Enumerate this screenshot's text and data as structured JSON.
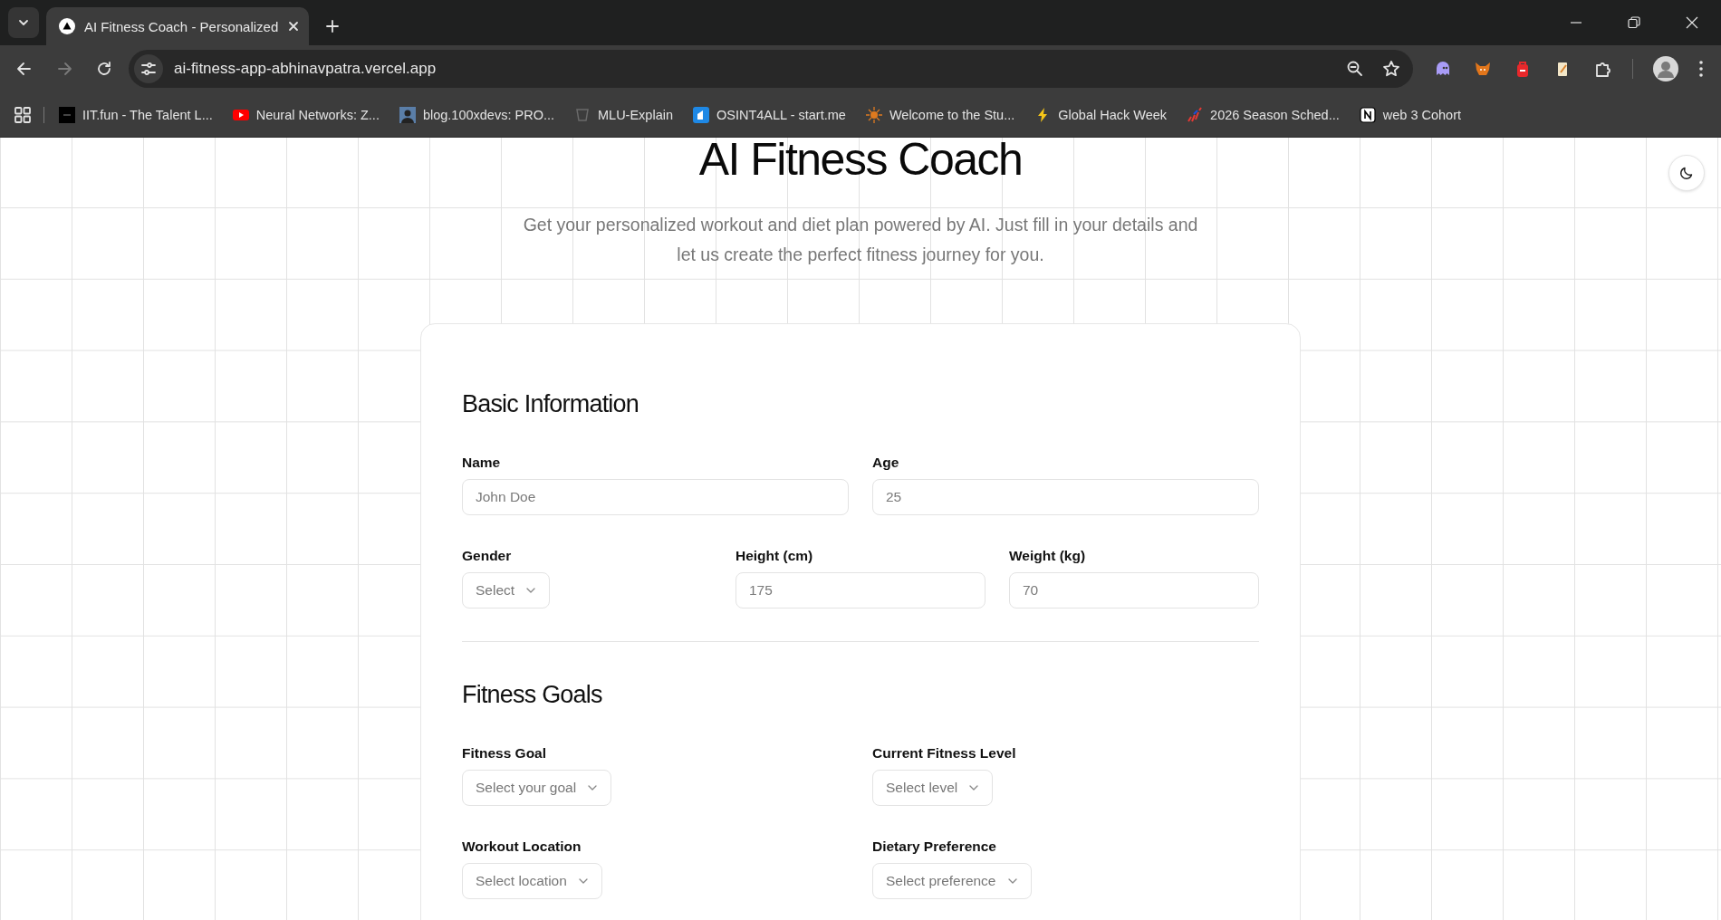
{
  "browser": {
    "tabs": [
      {
        "title": "AI Fitness Coach - Personalized",
        "selected": true
      }
    ],
    "nav": [
      {
        "kind": "back",
        "disabled": false
      },
      {
        "kind": "forward",
        "disabled": true
      },
      {
        "kind": "reload",
        "disabled": false
      }
    ],
    "address": "ai-fitness-app-abhinavpatra.vercel.app",
    "extensions": [
      {
        "kind": "ghost"
      },
      {
        "kind": "fox"
      },
      {
        "kind": "backpack"
      },
      {
        "kind": "note"
      },
      {
        "kind": "puzzle"
      }
    ],
    "bookmarks": [
      {
        "label": "IIT.fun - The Talent L...",
        "kind": "square"
      },
      {
        "label": "Neural Networks: Z...",
        "kind": "play"
      },
      {
        "label": "blog.100xdevs: PRO...",
        "kind": "avatar"
      },
      {
        "label": "MLU-Explain",
        "kind": "outline"
      },
      {
        "label": "OSINT4ALL - start.me",
        "kind": "tile"
      },
      {
        "label": "Welcome to the Stu...",
        "kind": "sun"
      },
      {
        "label": "Global Hack Week",
        "kind": "bolt"
      },
      {
        "label": "2026 Season Sched...",
        "kind": "bars"
      },
      {
        "label": "web 3 Cohort",
        "kind": "notion"
      }
    ]
  },
  "page": {
    "title": "AI Fitness Coach",
    "subtitle": "Get your personalized workout and diet plan powered by AI. Just fill in your details and let us create the perfect fitness journey for you.",
    "sections": [
      {
        "heading": "Basic Information",
        "rows": [
          [
            {
              "label": "Name",
              "kind": "input",
              "placeholder": "John Doe"
            },
            {
              "label": "Age",
              "kind": "input",
              "placeholder": "25"
            }
          ],
          [
            {
              "label": "Gender",
              "kind": "select",
              "placeholder": "Select"
            },
            {
              "label": "Height (cm)",
              "kind": "input",
              "placeholder": "175"
            },
            {
              "label": "Weight (kg)",
              "kind": "input",
              "placeholder": "70"
            }
          ]
        ]
      },
      {
        "heading": "Fitness Goals",
        "rows": [
          [
            {
              "label": "Fitness Goal",
              "kind": "select",
              "placeholder": "Select your goal"
            },
            {
              "label": "Current Fitness Level",
              "kind": "select",
              "placeholder": "Select level"
            }
          ],
          [
            {
              "label": "Workout Location",
              "kind": "select",
              "placeholder": "Select location"
            },
            {
              "label": "Dietary Preference",
              "kind": "select",
              "placeholder": "Select preference"
            }
          ]
        ]
      }
    ]
  }
}
